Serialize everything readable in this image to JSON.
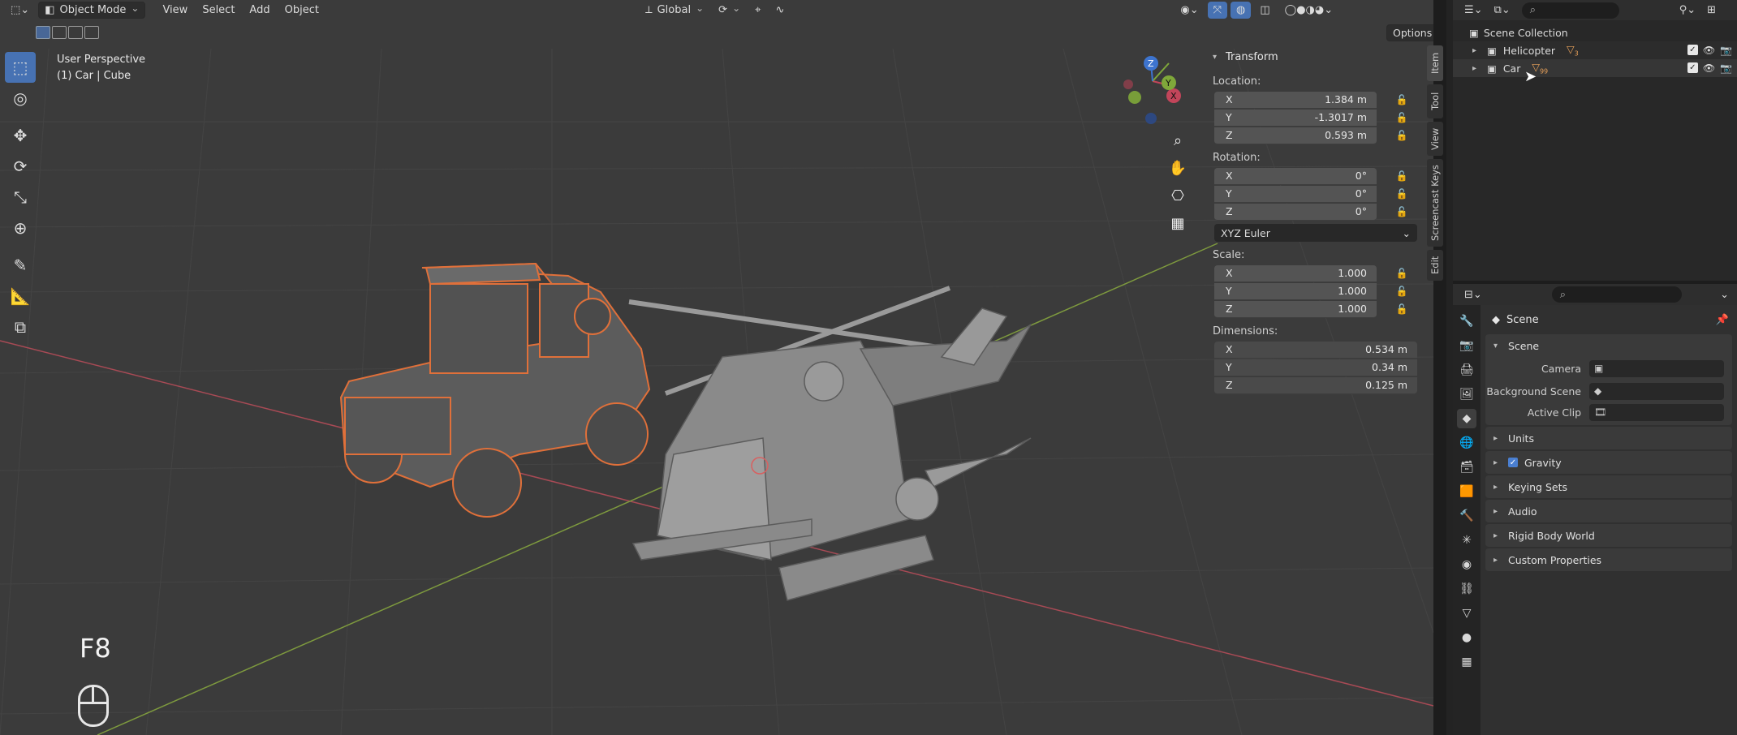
{
  "header": {
    "mode": "Object Mode",
    "menu": [
      "View",
      "Select",
      "Add",
      "Object"
    ],
    "orientation": "Global",
    "options_label": "Options"
  },
  "viewport": {
    "perspective_label": "User Perspective",
    "active_object_label": "(1) Car | Cube",
    "key_overlay": "F8",
    "gizmo_axes": [
      "X",
      "Y",
      "Z"
    ]
  },
  "toolbar": {
    "tools": [
      "select-box-icon",
      "cursor-icon",
      "move-icon",
      "rotate-icon",
      "scale-icon",
      "transform-icon",
      "annotate-icon",
      "measure-icon",
      "add-cube-icon"
    ]
  },
  "transform": {
    "title": "Transform",
    "location_label": "Location:",
    "location": [
      {
        "axis": "X",
        "value": "1.384 m"
      },
      {
        "axis": "Y",
        "value": "-1.3017 m"
      },
      {
        "axis": "Z",
        "value": "0.593 m"
      }
    ],
    "rotation_label": "Rotation:",
    "rotation": [
      {
        "axis": "X",
        "value": "0°"
      },
      {
        "axis": "Y",
        "value": "0°"
      },
      {
        "axis": "Z",
        "value": "0°"
      }
    ],
    "rotation_mode": "XYZ Euler",
    "scale_label": "Scale:",
    "scale": [
      {
        "axis": "X",
        "value": "1.000"
      },
      {
        "axis": "Y",
        "value": "1.000"
      },
      {
        "axis": "Z",
        "value": "1.000"
      }
    ],
    "dimensions_label": "Dimensions:",
    "dimensions": [
      {
        "axis": "X",
        "value": "0.534 m"
      },
      {
        "axis": "Y",
        "value": "0.34 m"
      },
      {
        "axis": "Z",
        "value": "0.125 m"
      }
    ]
  },
  "sidebar_tabs": [
    "Item",
    "Tool",
    "View",
    "Screencast Keys",
    "Edit"
  ],
  "outliner": {
    "root": "Scene Collection",
    "items": [
      {
        "name": "Helicopter",
        "badge": "3"
      },
      {
        "name": "Car",
        "badge": "99"
      }
    ]
  },
  "properties": {
    "context": "Scene",
    "section": "Scene",
    "fields": [
      {
        "label": "Camera",
        "value": ""
      },
      {
        "label": "Background Scene",
        "value": ""
      },
      {
        "label": "Active Clip",
        "value": ""
      }
    ],
    "panels": [
      "Units",
      "Gravity",
      "Keying Sets",
      "Audio",
      "Rigid Body World",
      "Custom Properties"
    ],
    "gravity_checked": true
  },
  "colors": {
    "viewport_bg": "#3b3b3b",
    "selection_orange": "#e0703a",
    "accent_blue": "#4772b3",
    "axis_x": "#c2455a",
    "axis_y": "#7fa83a",
    "axis_z": "#3d74cf"
  }
}
